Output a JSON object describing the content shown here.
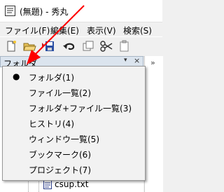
{
  "window": {
    "title": "(無題) - 秀丸"
  },
  "menubar": {
    "items": [
      "ファイル(F)",
      "編集(E)",
      "表示(V)",
      "検索(S)"
    ]
  },
  "toolbar": {
    "buttons": [
      "new-file-icon",
      "open-folder-icon",
      "save-icon",
      "undo-icon",
      "copy-icon",
      "cut-icon"
    ]
  },
  "pane": {
    "title": "フォルダ",
    "dropdown_glyph": "▾",
    "close_glyph": "×"
  },
  "popup": {
    "items": [
      {
        "label": "フォルダ(1)",
        "checked": true,
        "check_glyph": "●"
      },
      {
        "label": "ファイル一覧(2)",
        "checked": false,
        "check_glyph": ""
      },
      {
        "label": "フォルダ+ファイル一覧(3)",
        "checked": false,
        "check_glyph": ""
      },
      {
        "label": "ヒストリ(4)",
        "checked": false,
        "check_glyph": ""
      },
      {
        "label": "ウィンドウ一覧(5)",
        "checked": false,
        "check_glyph": ""
      },
      {
        "label": "ブックマーク(6)",
        "checked": false,
        "check_glyph": ""
      },
      {
        "label": "プロジェクト(7)",
        "checked": false,
        "check_glyph": ""
      }
    ]
  },
  "tree": {
    "visible_file": "csup.txt"
  },
  "right_panel": {
    "mark": "»"
  },
  "colors": {
    "annotation_arrow": "#ff0000",
    "pane_header_bg": "#dbe4ee"
  }
}
